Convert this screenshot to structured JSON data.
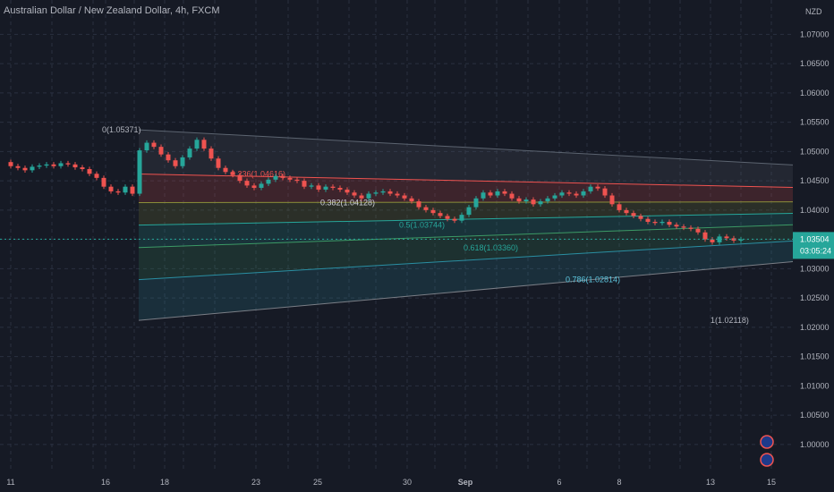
{
  "chart_data": {
    "type": "candlestick",
    "title": "Australian Dollar / New Zealand Dollar, 4h, FXCM",
    "unit": "NZD",
    "ylim": [
      0.998,
      1.0725
    ],
    "yticks": [
      "1.07000",
      "1.06500",
      "1.06000",
      "1.05500",
      "1.05000",
      "1.04500",
      "1.04000",
      "1.03500",
      "1.03000",
      "1.02500",
      "1.02000",
      "1.01500",
      "1.01000",
      "1.00500",
      "1.00000"
    ],
    "xticks": [
      "11",
      "16",
      "18",
      "23",
      "25",
      "30",
      "Sep",
      "6",
      "8",
      "13",
      "15"
    ],
    "last_price": "1.03504",
    "countdown": "03:05:24",
    "fib_levels": [
      {
        "label": "0(1.05371)",
        "value": 1.05371
      },
      {
        "label": "0.236(1.04616)",
        "value": 1.04616
      },
      {
        "label": "0.382(1.04128)",
        "value": 1.04128
      },
      {
        "label": "0.5(1.03744)",
        "value": 1.03744
      },
      {
        "label": "0.618(1.03360)",
        "value": 1.0336
      },
      {
        "label": "0.786(1.02814)",
        "value": 1.02814
      },
      {
        "label": "1(1.02118)",
        "value": 1.02118
      }
    ],
    "colors": {
      "up": "#26a69a",
      "down": "#ef5350",
      "background": "#161a25",
      "text": "#b2b5be",
      "grid": "#2a3040"
    },
    "ohlc_path": [
      1.0482,
      1.0475,
      1.0472,
      1.0468,
      1.0474,
      1.0476,
      1.0478,
      1.0475,
      1.048,
      1.0478,
      1.0473,
      1.047,
      1.0462,
      1.0455,
      1.044,
      1.0432,
      1.043,
      1.044,
      1.0428,
      1.0502,
      1.0515,
      1.0508,
      1.0495,
      1.0485,
      1.0475,
      1.049,
      1.0505,
      1.052,
      1.0505,
      1.0488,
      1.0472,
      1.0465,
      1.046,
      1.045,
      1.0442,
      1.0438,
      1.0445,
      1.0452,
      1.0458,
      1.0455,
      1.0452,
      1.045,
      1.044,
      1.0442,
      1.0435,
      1.044,
      1.0438,
      1.0435,
      1.043,
      1.0425,
      1.042,
      1.0428,
      1.043,
      1.0432,
      1.0428,
      1.0425,
      1.042,
      1.0415,
      1.0405,
      1.04,
      1.0395,
      1.039,
      1.0385,
      1.0382,
      1.0392,
      1.0405,
      1.042,
      1.043,
      1.0425,
      1.0432,
      1.0428,
      1.042,
      1.0415,
      1.0418,
      1.041,
      1.0415,
      1.042,
      1.0425,
      1.043,
      1.0428,
      1.0425,
      1.0432,
      1.044,
      1.0437,
      1.0425,
      1.041,
      1.04,
      1.0395,
      1.039,
      1.0385,
      1.038,
      1.0378,
      1.038,
      1.0375,
      1.0372,
      1.037,
      1.0368,
      1.0362,
      1.035,
      1.0345,
      1.0355,
      1.0352,
      1.0348,
      1.035
    ]
  }
}
